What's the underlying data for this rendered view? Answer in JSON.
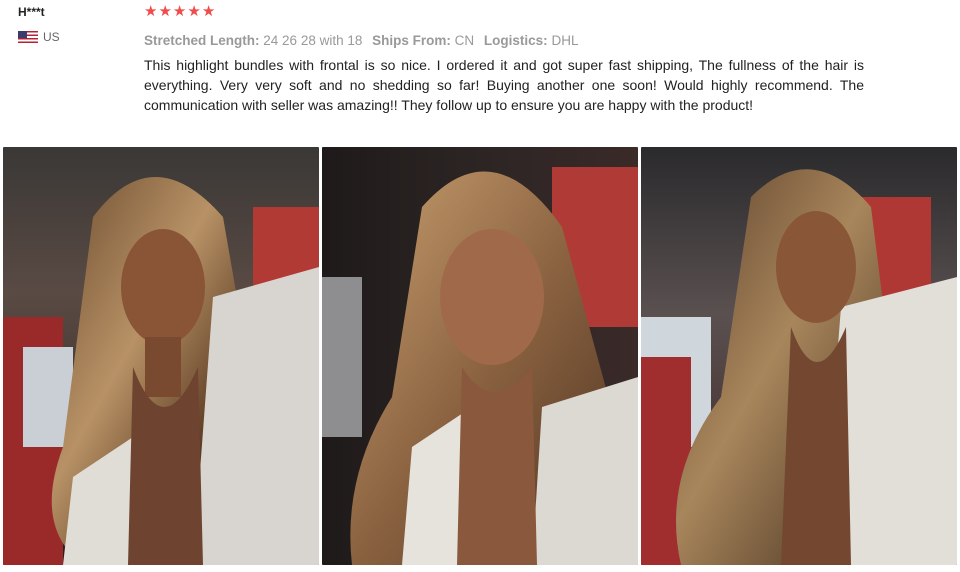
{
  "reviewer": {
    "name": "H***t",
    "country_code": "US",
    "flag_icon": "us-flag-icon"
  },
  "review": {
    "rating": 5,
    "star_color": "#f04c4c",
    "meta": [
      {
        "key": "Stretched Length:",
        "value": "24 26 28 with 18"
      },
      {
        "key": "Ships From:",
        "value": "CN"
      },
      {
        "key": "Logistics:",
        "value": "DHL"
      }
    ],
    "text": "This highlight bundles with frontal is so nice. I ordered it and got super fast shipping, The fullness of the hair is everything. Very very soft and no shedding so far! Buying another one soon! Would highly recommend. The communication with seller was amazing!! They follow up to ensure you are happy with the product!"
  },
  "photos": [
    {
      "icon": "review-photo-1"
    },
    {
      "icon": "review-photo-2"
    },
    {
      "icon": "review-photo-3"
    }
  ]
}
